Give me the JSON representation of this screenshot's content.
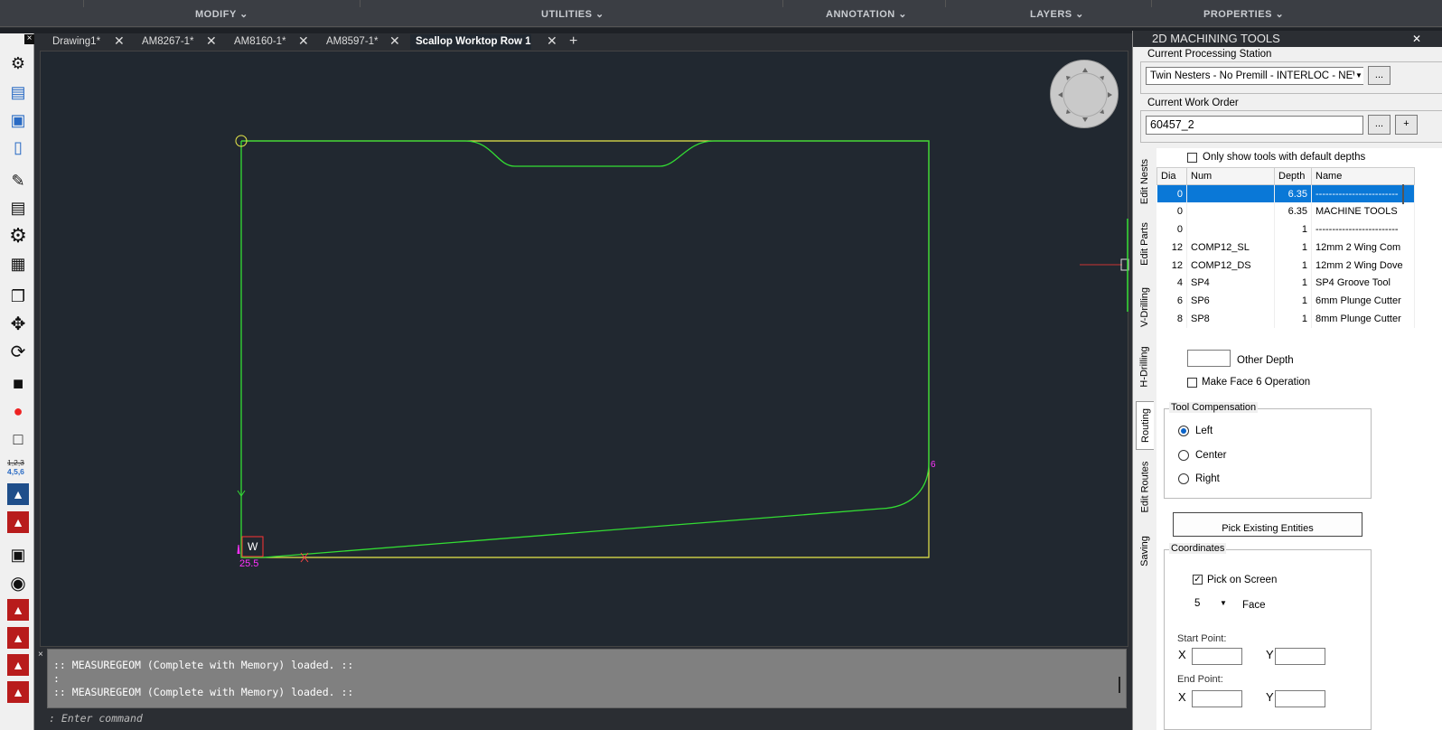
{
  "ribbon": {
    "modify": "MODIFY",
    "utilities": "UTILITIES",
    "annotation": "ANNOTATION",
    "layers": "LAYERS",
    "properties": "PROPERTIES"
  },
  "tabs": [
    {
      "label": "Drawing1*"
    },
    {
      "label": "AM8267-1*"
    },
    {
      "label": "AM8160-1*"
    },
    {
      "label": "AM8597-1*"
    },
    {
      "label": "Scallop Worktop Row 1"
    }
  ],
  "toolbar": {
    "numbers_top": "1,2,3",
    "numbers_bottom": "4,5,6"
  },
  "canvas": {
    "origin_label": "W",
    "dim_label": "25.5",
    "edge_mark": "6"
  },
  "command": {
    "lines": [
      ":: MEASUREGEOM (Complete with Memory) loaded. ::",
      ":",
      ":: MEASUREGEOM (Complete with Memory) loaded. ::"
    ],
    "prompt": ": Enter command"
  },
  "panel": {
    "title": "2D MACHINING TOOLS",
    "station_label": "Current Processing Station",
    "station_value": "Twin Nesters - No Premill - INTERLOC - NEW C",
    "browse": "...",
    "work_order_label": "Current Work Order",
    "work_order_value": "60457_2",
    "add": "+",
    "vtabs": [
      "Edit Nests",
      "Edit Parts",
      "V-Drilling",
      "H-Drilling",
      "Routing",
      "Edit Routes",
      "Saving"
    ],
    "only_default": "Only show tools with default depths",
    "columns": [
      "Dia",
      "Num",
      "Depth",
      "Name"
    ],
    "rows": [
      {
        "dia": "0",
        "num": "",
        "depth": "6.35",
        "name": "-------------------------"
      },
      {
        "dia": "0",
        "num": "",
        "depth": "6.35",
        "name": "MACHINE TOOLS"
      },
      {
        "dia": "0",
        "num": "",
        "depth": "1",
        "name": "-------------------------"
      },
      {
        "dia": "12",
        "num": "COMP12_SL",
        "depth": "1",
        "name": "12mm 2 Wing Com"
      },
      {
        "dia": "12",
        "num": "COMP12_DS",
        "depth": "1",
        "name": "12mm 2 Wing Dove"
      },
      {
        "dia": "4",
        "num": "SP4",
        "depth": "1",
        "name": "SP4 Groove Tool"
      },
      {
        "dia": "6",
        "num": "SP6",
        "depth": "1",
        "name": "6mm Plunge Cutter"
      },
      {
        "dia": "8",
        "num": "SP8",
        "depth": "1",
        "name": "8mm Plunge Cutter"
      }
    ],
    "other_depth": "Other Depth",
    "make_face6": "Make Face 6 Operation",
    "tool_comp": "Tool Compensation",
    "left": "Left",
    "center": "Center",
    "right": "Right",
    "pick_existing": "Pick Existing Entities",
    "coordinates": "Coordinates",
    "pick_screen": "Pick on Screen",
    "face_value": "5",
    "face_label": "Face",
    "start_point": "Start Point:",
    "end_point": "End Point:",
    "x": "X",
    "y": "Y"
  },
  "colors": {
    "part_outline": "#e8e84a",
    "route": "#33dd33",
    "marker": "#ff33ff",
    "selection": "#0a78d7"
  }
}
